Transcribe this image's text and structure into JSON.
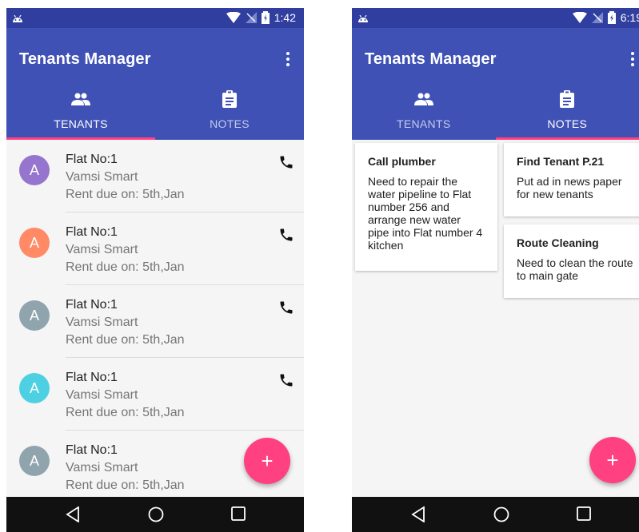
{
  "left": {
    "status": {
      "time": "1:42"
    },
    "app_title": "Tenants Manager",
    "tabs": [
      {
        "label": "TENANTS",
        "icon": "group-icon",
        "active": true
      },
      {
        "label": "NOTES",
        "icon": "clipboard-icon",
        "active": false
      }
    ],
    "tenants": [
      {
        "initial": "A",
        "flat": "Flat No:1",
        "name": "Vamsi Smart",
        "rent": "Rent due on: 5th,Jan",
        "avatar_color": "#9575cd",
        "has_phone": true
      },
      {
        "initial": "A",
        "flat": "Flat No:1",
        "name": "Vamsi Smart",
        "rent": "Rent due on: 5th,Jan",
        "avatar_color": "#ff8a65",
        "has_phone": true
      },
      {
        "initial": "A",
        "flat": "Flat No:1",
        "name": "Vamsi Smart",
        "rent": "Rent due on: 5th,Jan",
        "avatar_color": "#90a4ae",
        "has_phone": true
      },
      {
        "initial": "A",
        "flat": "Flat No:1",
        "name": "Vamsi Smart",
        "rent": "Rent due on: 5th,Jan",
        "avatar_color": "#4dd0e1",
        "has_phone": true
      },
      {
        "initial": "A",
        "flat": "Flat No:1",
        "name": "Vamsi Smart",
        "rent": "Rent due on: 5th,Jan",
        "avatar_color": "#90a4ae",
        "has_phone": false
      }
    ],
    "fab_label": "+"
  },
  "right": {
    "status": {
      "time": "6:19"
    },
    "app_title": "Tenants Manager",
    "tabs": [
      {
        "label": "TENANTS",
        "icon": "group-icon",
        "active": false
      },
      {
        "label": "NOTES",
        "icon": "clipboard-icon",
        "active": true
      }
    ],
    "notes": [
      {
        "title": "Call plumber",
        "body": "Need to repair the water pipeline to Flat number 256 and arrange new water pipe into Flat number 4 kitchen"
      },
      {
        "title": "Find Tenant P.21",
        "body": "Put ad in news paper for new tenants"
      },
      {
        "title": "Route Cleaning",
        "body": "Need to clean the route to main gate"
      }
    ],
    "fab_label": "+"
  },
  "colors": {
    "primary": "#3f51b5",
    "primary_dark": "#303f9f",
    "accent": "#ff4081"
  }
}
